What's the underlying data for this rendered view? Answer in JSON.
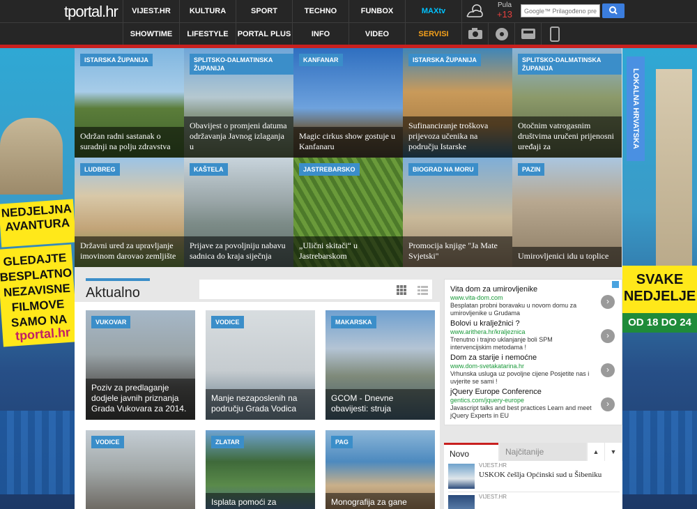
{
  "header": {
    "logo": "tportal.hr",
    "nav_row1": [
      "VIJEST.HR",
      "KULTURA",
      "SPORT",
      "TECHNO",
      "FUNBOX",
      "MAXtv"
    ],
    "nav_row2": [
      "SHOWTIME",
      "LIFESTYLE",
      "PORTAL PLUS",
      "INFO",
      "VIDEO",
      "SERVISI"
    ],
    "weather": {
      "city": "Pula",
      "temp": "+13"
    },
    "search_placeholder": "Google™ Prilagođeno pret",
    "colors": {
      "special": "#00c2ff",
      "orange": "#f7a21b"
    }
  },
  "ads": {
    "left": {
      "line1": "NEDJELJNA AVANTURA",
      "line2": "GLEDAJTE BESPLATNO NEZAVISNE FILMOVE SAMO NA",
      "brand": "tportal.hr"
    },
    "right": {
      "vertical": "LOKALNA HRVATSKA",
      "line1": "SVAKE NEDJELJE",
      "line2": "OD 18 DO 24"
    }
  },
  "local_grid": [
    {
      "tag": "ISTARSKA ŽUPANIJA",
      "caption": "Održan radni sastanak o suradnji na polju zdravstva"
    },
    {
      "tag": "SPLITSKO-DALMATINSKA ŽUPANIJA",
      "caption": "Obavijest o promjeni datuma održavanja Javnog izlaganja u"
    },
    {
      "tag": "KANFANAR",
      "caption": "Magic cirkus show gostuje u Kanfanaru"
    },
    {
      "tag": "ISTARSKA ŽUPANIJA",
      "caption": "Sufinanciranje troškova prijevoza učenika na području Istarske"
    },
    {
      "tag": "SPLITSKO-DALMATINSKA ŽUPANIJA",
      "caption": "Otočnim vatrogasnim društvima uručeni prijenosni uređaji za"
    },
    {
      "tag": "LUDBREG",
      "caption": "Državni ured za upravljanje imovinom darovao zemljište"
    },
    {
      "tag": "KAŠTELA",
      "caption": "Prijave za povoljniju nabavu sadnica do kraja siječnja"
    },
    {
      "tag": "JASTREBARSKO",
      "caption": "„Ulični skitači“ u Jastrebarskom"
    },
    {
      "tag": "BIOGRAD NA MORU",
      "caption": "Promocija knjige \"Ja Mate Svjetski\""
    },
    {
      "tag": "PAZIN",
      "caption": "Umirovljenici idu u toplice"
    }
  ],
  "aktualno": {
    "title": "Aktualno",
    "cards": [
      {
        "tag": "VUKOVAR",
        "caption": "Poziv za predlaganje dodjele javnih priznanja Grada Vukovara za 2014."
      },
      {
        "tag": "VODICE",
        "caption": "Manje nezaposlenih na području Grada Vodica"
      },
      {
        "tag": "MAKARSKA",
        "caption": "GCOM - Dnevne obavijesti: struja"
      },
      {
        "tag": "VODICE",
        "caption": ""
      },
      {
        "tag": "ZLATAR",
        "caption": "Isplata pomoći za"
      },
      {
        "tag": "PAG",
        "caption": "Monografija za gane"
      }
    ]
  },
  "sidebar_ads": [
    {
      "title": "Vita dom za umirovljenike",
      "url": "www.vita-dom.com",
      "desc": "Besplatan probni boravaku u novom domu za umirovljenike u Grudama"
    },
    {
      "title": "Bolovi u kralježnici ?",
      "url": "www.arithera.hr/kraljeznica",
      "desc": "Trenutno i trajno uklanjanje boli SPM intervencijskim metodama !"
    },
    {
      "title": "Dom za starije i nemoćne",
      "url": "www.dom-svetakatarina.hr",
      "desc": "Vrhunska usluga uz povoljne cijene Posjetite nas i uvjerite se sami !"
    },
    {
      "title": "jQuery Europe Conference",
      "url": "gentics.com/jquery-europe",
      "desc": "Javascript talks and best practices Learn and meet jQuery Experts in EU"
    }
  ],
  "news_tabs": {
    "tab1": "Novo",
    "tab2": "Najčitanije",
    "up": "▲",
    "down": "▼"
  },
  "news": [
    {
      "source": "VIJEST.HR",
      "title": "USKOK češlja Općinski sud u Šibeniku"
    },
    {
      "source": "VIJEST.HR",
      "title": ""
    }
  ]
}
